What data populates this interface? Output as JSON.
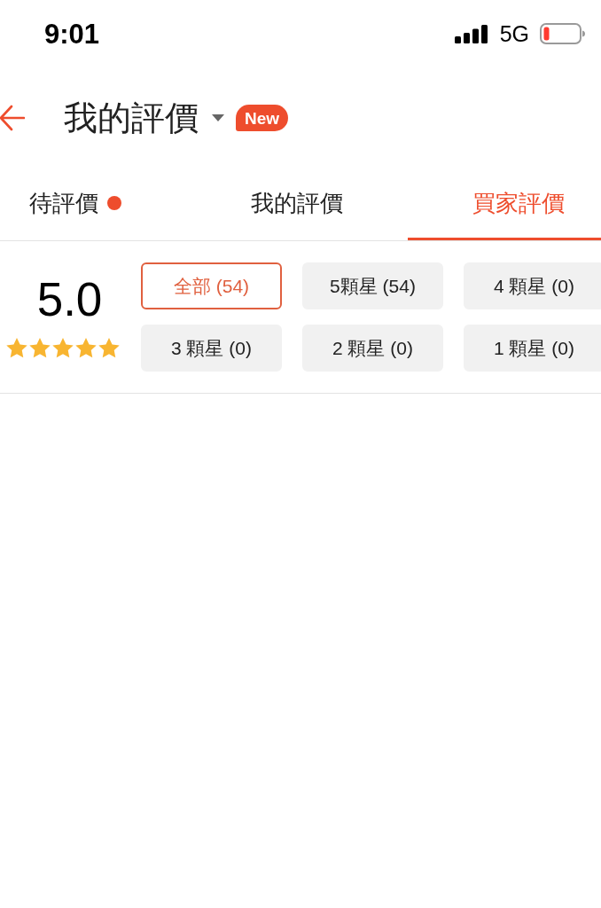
{
  "status_bar": {
    "time": "9:01",
    "network": "5G"
  },
  "header": {
    "title": "我的評價",
    "badge": "New"
  },
  "tabs": [
    {
      "label": "待評價",
      "selected": false,
      "dot": true
    },
    {
      "label": "我的評價",
      "selected": false,
      "dot": false
    },
    {
      "label": "買家評價",
      "selected": true,
      "dot": false
    }
  ],
  "rating": {
    "score": "5.0",
    "stars": 5
  },
  "filters": [
    {
      "label": "全部 (54)",
      "selected": true
    },
    {
      "label": "5顆星 (54)",
      "selected": false
    },
    {
      "label": "4 顆星 (0)",
      "selected": false
    },
    {
      "label": "3 顆星 (0)",
      "selected": false
    },
    {
      "label": "2 顆星 (0)",
      "selected": false
    },
    {
      "label": "1 顆星 (0)",
      "selected": false
    }
  ]
}
